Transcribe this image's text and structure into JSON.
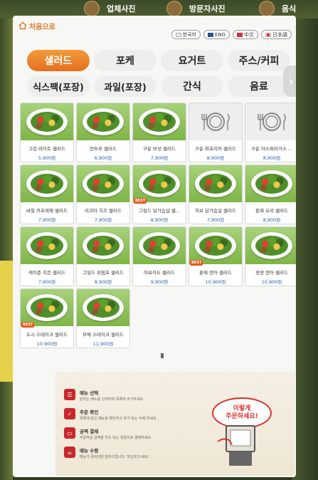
{
  "environment": {
    "signs": [
      "업체사진",
      "방문자사진",
      "음식"
    ]
  },
  "screen": {
    "home_label": "처음으로",
    "languages": [
      {
        "label": "한국어",
        "flag_color": "#e8e8e8"
      },
      {
        "label": "ENG",
        "flag_color": "#2f4c9c"
      },
      {
        "label": "中文",
        "flag_color": "#d92c2c"
      },
      {
        "label": "日本語",
        "flag_color": "#ffffff"
      }
    ],
    "tabs": [
      {
        "label": "샐러드",
        "active": true
      },
      {
        "label": "포케",
        "active": false
      },
      {
        "label": "요거트",
        "active": false
      },
      {
        "label": "주스/커피",
        "active": false
      },
      {
        "label": "식스팩(포장)",
        "active": false
      },
      {
        "label": "과일(포장)",
        "active": false
      },
      {
        "label": "간식",
        "active": false
      },
      {
        "label": "음료",
        "active": false
      }
    ],
    "best_badge": "BEST",
    "items": [
      {
        "name": "그린 라이트 샐러드",
        "price": "5,900원",
        "photo": true,
        "best": false
      },
      {
        "name": "연두부 샐러드",
        "price": "6,900원",
        "photo": true,
        "best": false
      },
      {
        "name": "구운 버섯 샐러드",
        "price": "7,900원",
        "photo": true,
        "best": false
      },
      {
        "name": "구운 파프리카 샐러드",
        "price": "8,900원",
        "photo": false,
        "best": false
      },
      {
        "name": "구운 아스파라거스 ...",
        "price": "8,900원",
        "photo": false,
        "best": false
      },
      {
        "name": "바질 카프레제 샐러드",
        "price": "7,900원",
        "photo": true,
        "best": false
      },
      {
        "name": "리코타 치즈 샐러드",
        "price": "7,900원",
        "photo": true,
        "best": false
      },
      {
        "name": "그릴드 닭가슴살 샐...",
        "price": "8,900원",
        "photo": true,
        "best": true
      },
      {
        "name": "허브 닭가슴살 샐러드",
        "price": "7,900원",
        "photo": true,
        "best": false
      },
      {
        "name": "훈제 오리 샐러드",
        "price": "8,900원",
        "photo": true,
        "best": false
      },
      {
        "name": "케이준 치킨 샐러드",
        "price": "7,900원",
        "photo": true,
        "best": false
      },
      {
        "name": "그릴드 쉬림프 샐러드",
        "price": "8,900원",
        "photo": true,
        "best": false
      },
      {
        "name": "아보카도 샐러드",
        "price": "9,900원",
        "photo": true,
        "best": false
      },
      {
        "name": "훈제 연어 샐러드",
        "price": "10,900원",
        "photo": true,
        "best": true
      },
      {
        "name": "생생 연어 샐러드",
        "price": "10,900원",
        "photo": true,
        "best": false
      },
      {
        "name": "도시 스테이크 샐러드",
        "price": "10,900원",
        "photo": true,
        "best": true
      },
      {
        "name": "부채 스테이크 샐러드",
        "price": "11,900원",
        "photo": true,
        "best": false
      }
    ],
    "guide": {
      "steps": [
        {
          "title": "메뉴 선택",
          "desc": "원하는 메뉴를 선택하여 목록에 추가하세요"
        },
        {
          "title": "주문 확인",
          "desc": "목록에 담긴 메뉴를 확인하고 추가 또는 삭제 하세요."
        },
        {
          "title": "금액 결제",
          "desc": "주문하실 금액을 카드 또는 현금으로 결제하세요."
        },
        {
          "title": "메뉴 수령",
          "desc": "메뉴가 준비되면 알려드립니다. 맛있게 드세요!"
        }
      ],
      "bubble_line1": "이렇게",
      "bubble_line2": "주문하세요!"
    }
  }
}
